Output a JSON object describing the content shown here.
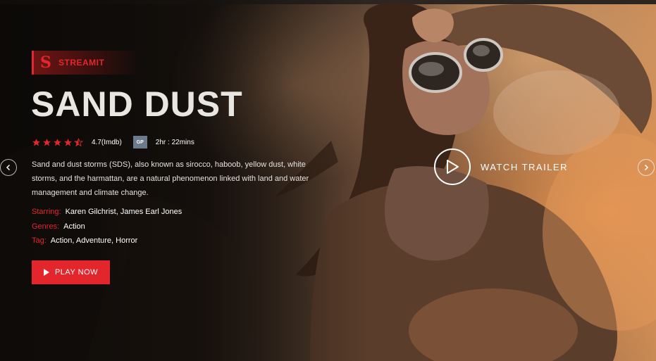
{
  "brand": {
    "name": "STREAMIT",
    "mark": "S",
    "accent_color": "#e3262c"
  },
  "movie": {
    "title": "SAND DUST",
    "rating_stars": 4.5,
    "rating_max": 5,
    "rating_text": "4.7(Imdb)",
    "age_badge": "GP",
    "duration": "2hr : 22mins",
    "description": "Sand and dust storms (SDS), also known as sirocco, haboob, yellow dust, white storms, and the harmattan, are a natural phenomenon linked with land and water management and climate change.",
    "starring_label": "Starring:",
    "starring_value": "Karen Gilchrist, James Earl Jones",
    "genres_label": "Genres:",
    "genres_value": "Action",
    "tag_label": "Tag:",
    "tag_value": "Action, Adventure, Horror"
  },
  "actions": {
    "play_label": "PLAY NOW",
    "trailer_label": "WATCH TRAILER"
  },
  "icons": {
    "prev": "chevron-left-icon",
    "next": "chevron-right-icon",
    "play": "play-icon",
    "star": "star-icon"
  }
}
